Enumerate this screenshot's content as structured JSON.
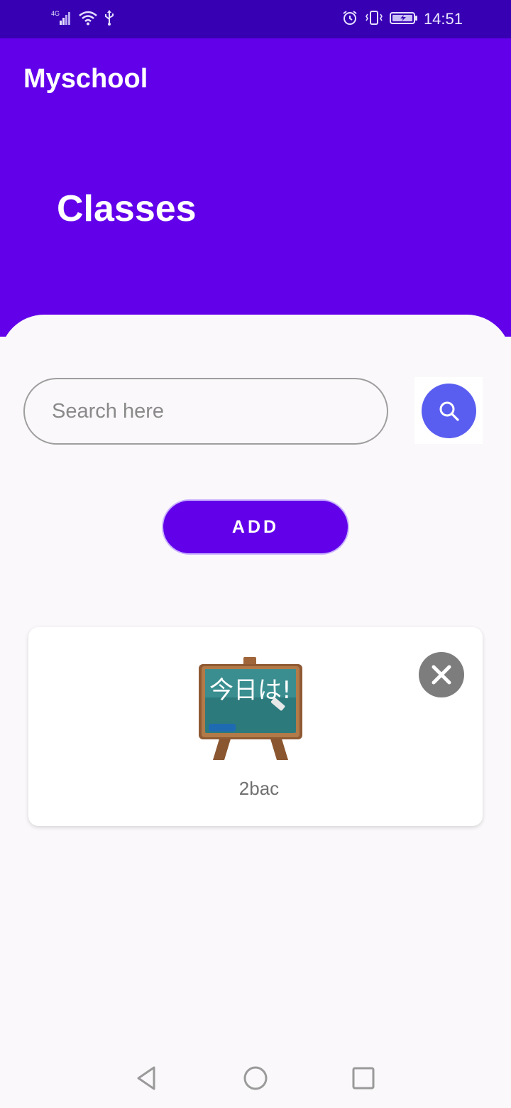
{
  "status_bar": {
    "network": "4G",
    "time": "14:51",
    "icons": [
      "signal-icon",
      "wifi-icon",
      "usb-icon",
      "alarm-icon",
      "vibrate-icon",
      "battery-charging-icon"
    ]
  },
  "app_bar": {
    "title": "Myschool",
    "page_title": "Classes"
  },
  "search": {
    "placeholder": "Search here",
    "value": ""
  },
  "actions": {
    "add_label": "ADD"
  },
  "classes": [
    {
      "name": "2bac",
      "icon": "chalkboard-icon",
      "board_text": "今日は!"
    }
  ],
  "colors": {
    "status_bar": "#3700b3",
    "primary": "#6200ea",
    "search_button": "#5a5ef0",
    "delete_button": "#7d7d7d",
    "background": "#faf8fa"
  },
  "nav_bar": [
    "back-icon",
    "home-icon",
    "recents-icon"
  ]
}
